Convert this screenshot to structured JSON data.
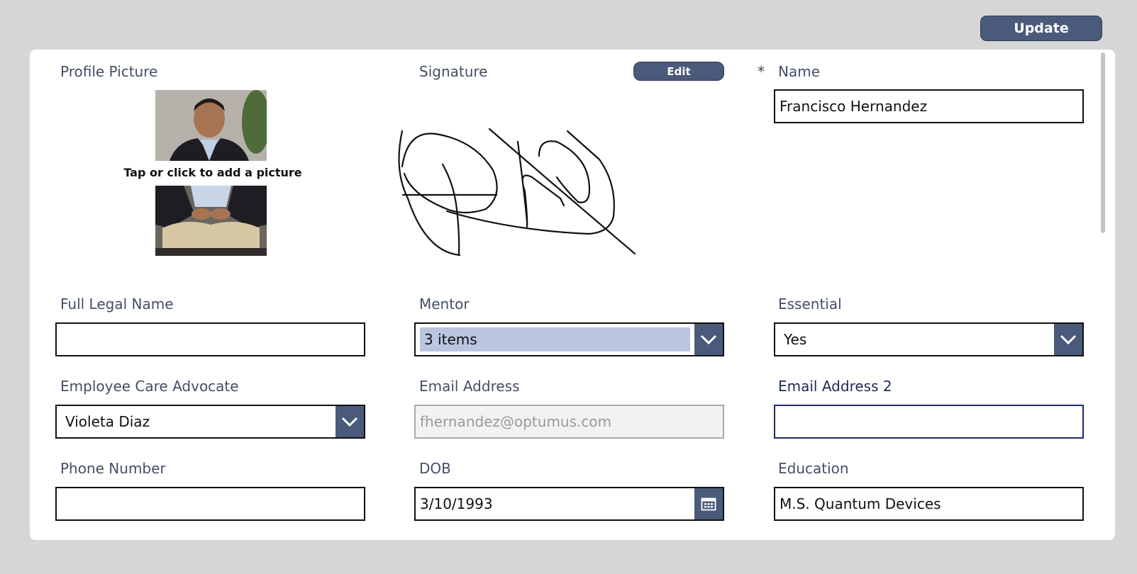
{
  "toolbar": {
    "update_label": "Update"
  },
  "profile": {
    "label": "Profile Picture",
    "hint": "Tap or click to add a picture"
  },
  "signature": {
    "label": "Signature",
    "edit_label": "Edit"
  },
  "name": {
    "required_marker": "*",
    "label": "Name",
    "value": "Francisco Hernandez"
  },
  "full_legal_name": {
    "label": "Full Legal Name",
    "value": ""
  },
  "mentor": {
    "label": "Mentor",
    "value": "3 items"
  },
  "essential": {
    "label": "Essential",
    "value": "Yes"
  },
  "care_advocate": {
    "label": "Employee Care Advocate",
    "value": "Violeta Diaz"
  },
  "email": {
    "label": "Email Address",
    "value": "fhernandez@optumus.com"
  },
  "email2": {
    "label": "Email Address 2",
    "value": ""
  },
  "phone": {
    "label": "Phone Number",
    "value": ""
  },
  "dob": {
    "label": "DOB",
    "value": "3/10/1993"
  },
  "education": {
    "label": "Education",
    "value": "M.S. Quantum Devices"
  },
  "colors": {
    "accent": "#4a5a7a",
    "chip": "#bac6e0",
    "focus": "#1d2a6e",
    "background": "#d6d6d6"
  },
  "icons": [
    "chevron-down-icon",
    "calendar-icon"
  ]
}
